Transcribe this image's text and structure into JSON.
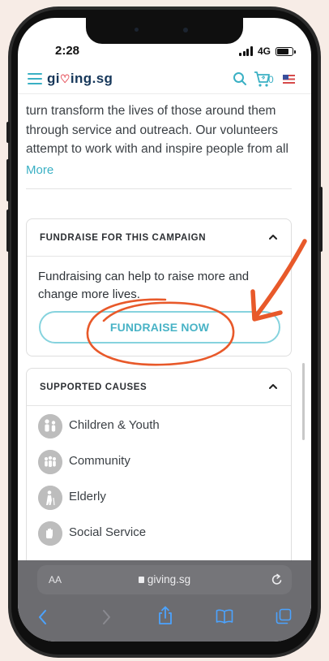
{
  "status_bar": {
    "time": "2:28",
    "network": "4G"
  },
  "nav": {
    "logo_part1": "gi",
    "logo_heart": "♡",
    "logo_part2": "ing.sg",
    "cart_count": "0",
    "icons": [
      "hamburger-menu-icon",
      "search-icon",
      "cart-icon",
      "flag-icon"
    ]
  },
  "description": {
    "lines": [
      "turn transform the lives of those around them",
      "through service and outreach. Our volunteers",
      "attempt to work with and inspire people from all"
    ],
    "more_label": "More"
  },
  "fundraise_card": {
    "title": "FUNDRAISE FOR THIS CAMPAIGN",
    "text": "Fundraising can help to raise more and change more lives.",
    "button_label": "FUNDRAISE NOW",
    "annotation_color": "#e8592a"
  },
  "causes_card": {
    "title": "SUPPORTED CAUSES",
    "items": [
      {
        "label": "Children & Youth",
        "icon": "children-youth-icon"
      },
      {
        "label": "Community",
        "icon": "community-icon"
      },
      {
        "label": "Elderly",
        "icon": "elderly-icon"
      },
      {
        "label": "Social Service",
        "icon": "social-service-icon"
      }
    ]
  },
  "browser": {
    "text_size_label": "AA",
    "url": "giving.sg",
    "toolbar_icons": [
      "back-icon",
      "forward-icon",
      "share-icon",
      "bookmarks-icon",
      "tabs-icon"
    ]
  },
  "colors": {
    "accent": "#3ab0c4",
    "brand_navy": "#16375a",
    "heart": "#e6515b"
  }
}
